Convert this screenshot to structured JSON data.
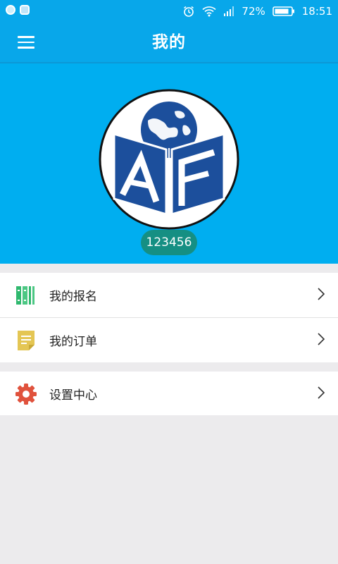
{
  "status_bar": {
    "battery_percent": "72%",
    "time": "18:51",
    "icons": [
      "app-notification-icon",
      "app-notification-icon",
      "alarm-icon",
      "wifi-icon",
      "signal-icon",
      "battery-icon"
    ]
  },
  "app_bar": {
    "title": "我的",
    "menu_icon": "hamburger-menu-icon"
  },
  "profile": {
    "username": "123456",
    "logo": "af-globe-book-logo"
  },
  "menu": {
    "items": [
      {
        "label": "我的报名",
        "icon": "books-icon",
        "color": "#2fb86e"
      },
      {
        "label": "我的订单",
        "icon": "note-icon",
        "color": "#e4c654"
      },
      {
        "label": "设置中心",
        "icon": "gear-icon",
        "color": "#e0523d"
      }
    ]
  },
  "colors": {
    "primary": "#08a7ea",
    "header_bg": "#00aef0",
    "badge": "#158f83",
    "page_bg": "#ecebed"
  }
}
